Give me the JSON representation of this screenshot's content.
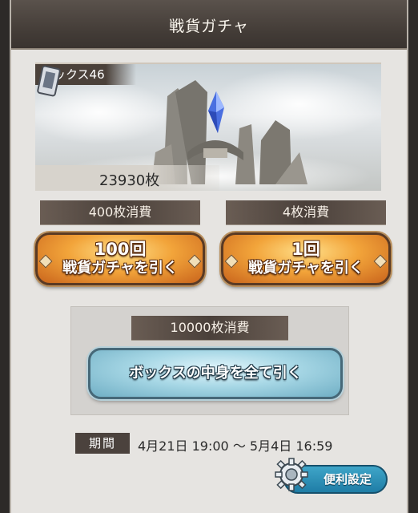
{
  "header": {
    "title": "戦貨ガチャ"
  },
  "banner": {
    "box_label": "ボックス46",
    "ticket_count": "23930枚"
  },
  "draws": [
    {
      "cost_label": "400枚消費",
      "button_line1": "100回",
      "button_line2": "戦貨ガチャを引く"
    },
    {
      "cost_label": "4枚消費",
      "button_line1": "1回",
      "button_line2": "戦貨ガチャを引く"
    }
  ],
  "box_draw": {
    "cost_label": "10000枚消費",
    "button_label": "ボックスの中身を全て引く"
  },
  "period": {
    "label": "期間",
    "text": "4月21日 19:00 ～ 5月4日 16:59"
  },
  "settings": {
    "button_label": "便利設定"
  },
  "colors": {
    "title_bar": "#423b36",
    "orange_button": "#f2a43a",
    "blue_button": "#a8d8e6",
    "settings_button": "#1f7da6",
    "panel_bg": "#e6e4e1"
  },
  "icons": {
    "ticket": "ticket-icon",
    "gear": "gear-icon",
    "crystal": "crystal-icon"
  }
}
